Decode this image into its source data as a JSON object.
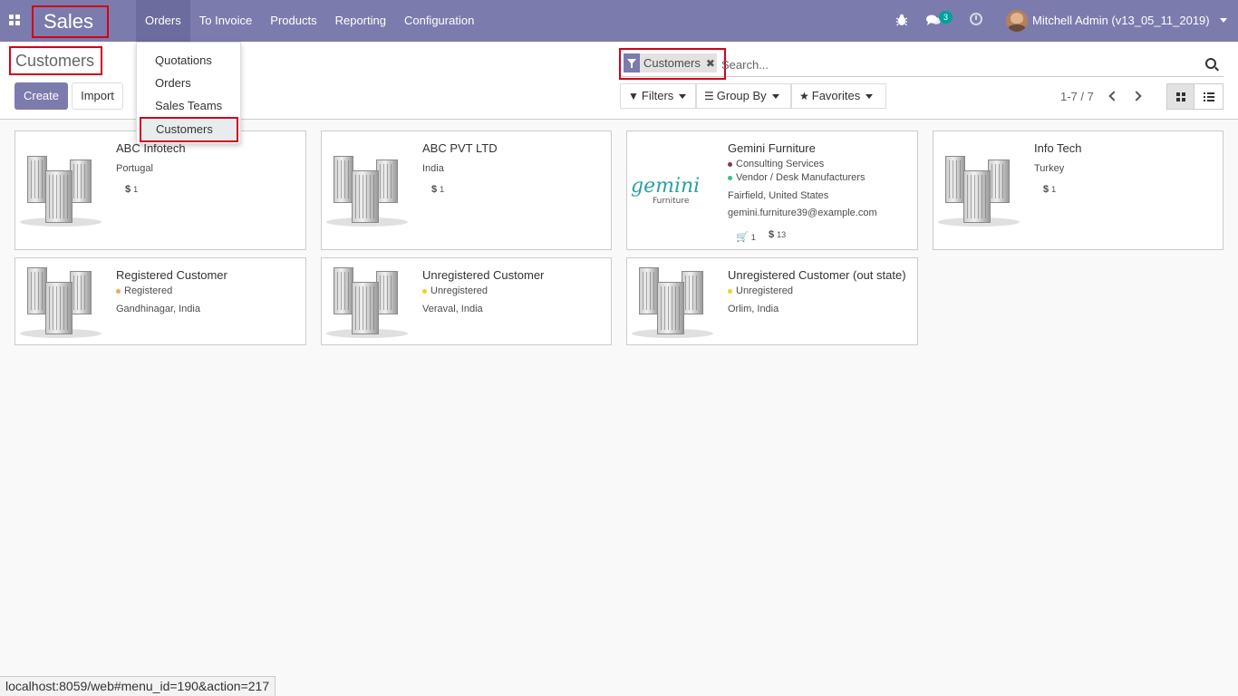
{
  "navbar": {
    "brand": "Sales",
    "menu": [
      "Orders",
      "To Invoice",
      "Products",
      "Reporting",
      "Configuration"
    ],
    "chat_count": "3",
    "user": "Mitchell Admin (v13_05_11_2019)",
    "color": "#7c7bad"
  },
  "dropdown": [
    "Quotations",
    "Orders",
    "Sales Teams",
    "Customers"
  ],
  "control": {
    "title": "Customers",
    "create": "Create",
    "import": "Import",
    "facet": "Customers",
    "search_placeholder": "Search...",
    "filters": "Filters",
    "group_by": "Group By",
    "favorites": "Favorites",
    "pager": "1-7 / 7"
  },
  "cards": [
    {
      "name": "ABC Infotech",
      "line1": "Portugal",
      "stat": "1"
    },
    {
      "name": "ABC PVT LTD",
      "line1": "India",
      "stat": "1"
    },
    {
      "name": "Gemini Furniture",
      "tag1": "Consulting Services",
      "tag2": "Vendor / Desk Manufacturers",
      "address": "Fairfield, United States",
      "email": "gemini.furniture39@example.com",
      "cart": "1",
      "stat": "13",
      "logo_top": "gemini",
      "logo_bottom": "Furniture"
    },
    {
      "name": "Info Tech",
      "line1": "Turkey",
      "stat": "1"
    },
    {
      "name": "Registered Customer",
      "tag1": "Registered",
      "address": "Gandhinagar, India"
    },
    {
      "name": "Unregistered Customer",
      "tag1": "Unregistered",
      "address": "Veraval, India"
    },
    {
      "name": "Unregistered Customer (out state)",
      "tag1": "Unregistered",
      "address": "Orlim, India"
    }
  ],
  "status_url": "localhost:8059/web#menu_id=190&action=217"
}
